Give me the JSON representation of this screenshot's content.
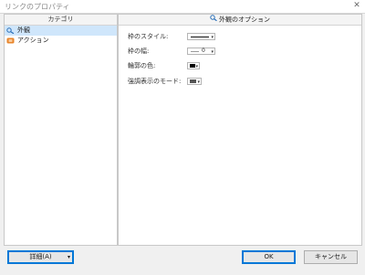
{
  "window": {
    "title": "リンクのプロパティ",
    "close_glyph": "✕"
  },
  "left_panel": {
    "header": "カテゴリ",
    "items": [
      {
        "label": "外観",
        "icon": "appearance-icon",
        "selected": true
      },
      {
        "label": "アクション",
        "icon": "action-icon",
        "selected": false
      }
    ]
  },
  "right_panel": {
    "header": "外観のオプション",
    "header_icon": "search-icon",
    "properties": [
      {
        "label": "枠のスタイル:",
        "control": "line-style-dropdown"
      },
      {
        "label": "枠の幅:",
        "control": "line-width-dropdown",
        "value": "0"
      },
      {
        "label": "輪郭の色:",
        "control": "color-picker",
        "value_color": "#000000"
      },
      {
        "label": "強調表示のモード:",
        "control": "highlight-mode-dropdown"
      }
    ]
  },
  "buttons": {
    "details": "詳細(A)",
    "ok": "OK",
    "cancel": "キャンセル"
  },
  "colors": {
    "selection": "#cfe6fb",
    "accent": "#0078d7",
    "panel_bg": "#ffffff",
    "window_bg": "#f0f0f0"
  }
}
